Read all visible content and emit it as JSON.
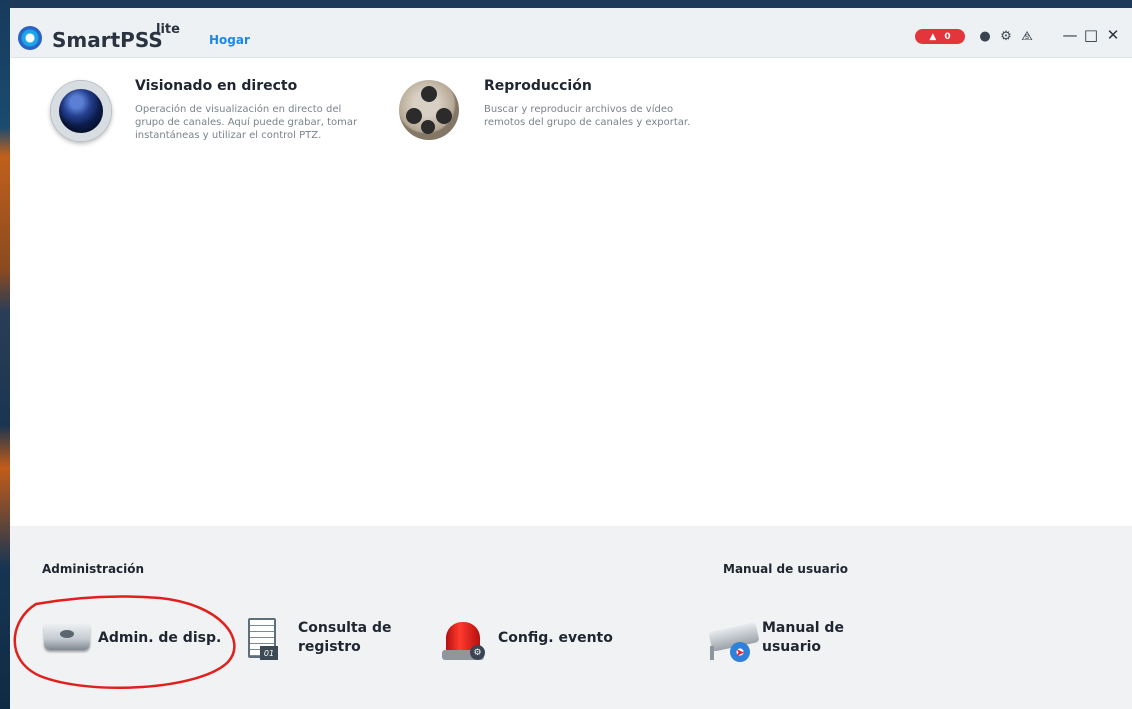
{
  "app": {
    "brand": "SmartPSS",
    "brand_sup": "lite",
    "home_tab": "Hogar",
    "alarm_count": "0"
  },
  "features": [
    {
      "title": "Visionado en directo",
      "desc": "Operación de visualización en directo del grupo de canales. Aquí puede grabar, tomar instantáneas y utilizar el control PTZ."
    },
    {
      "title": "Reproducción",
      "desc": "Buscar y reproducir archivos de vídeo remotos del grupo de canales y exportar."
    }
  ],
  "admin": {
    "heading": "Administración",
    "manual_heading": "Manual de usuario",
    "tools": [
      {
        "label": "Admin. de disp."
      },
      {
        "label": "Consulta de registro"
      },
      {
        "label": "Config. evento"
      },
      {
        "label": "Manual de usuario"
      }
    ],
    "log_date": "01"
  },
  "colors": {
    "accent": "#1e88e5",
    "alarm": "#e3353c",
    "annotation": "#e0201c"
  }
}
